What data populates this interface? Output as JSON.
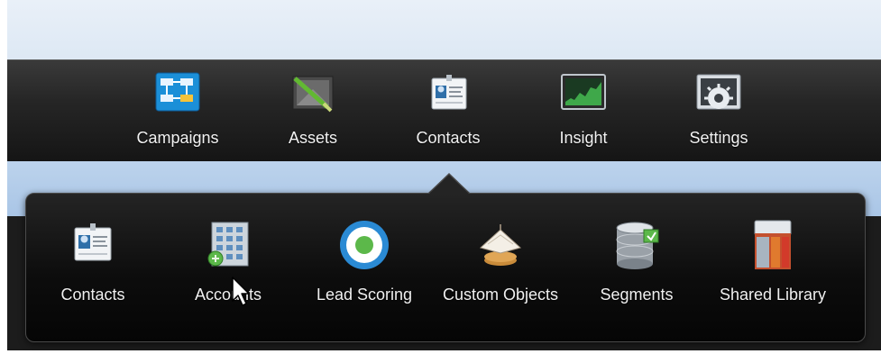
{
  "nav": {
    "items": [
      {
        "label": "Campaigns",
        "icon": "campaigns-flowchart-icon"
      },
      {
        "label": "Assets",
        "icon": "assets-icon"
      },
      {
        "label": "Contacts",
        "icon": "contact-card-icon"
      },
      {
        "label": "Insight",
        "icon": "insight-chart-icon"
      },
      {
        "label": "Settings",
        "icon": "settings-gear-icon"
      }
    ],
    "active_item": "Contacts"
  },
  "contacts_menu": {
    "items": [
      {
        "label": "Contacts",
        "icon": "contact-card-icon"
      },
      {
        "label": "Accounts",
        "icon": "accounts-building-icon"
      },
      {
        "label": "Lead Scoring",
        "icon": "lead-scoring-target-icon"
      },
      {
        "label": "Custom Objects",
        "icon": "custom-objects-icon"
      },
      {
        "label": "Segments",
        "icon": "segments-database-icon"
      },
      {
        "label": "Shared Library",
        "icon": "shared-library-icon"
      }
    ]
  },
  "colors": {
    "nav_bar": "#262626",
    "popup_bg": "#0d0d0d",
    "label_text": "#f0f0f0",
    "accent_blue": "#2a8ad4",
    "accent_green": "#5cb84a"
  }
}
